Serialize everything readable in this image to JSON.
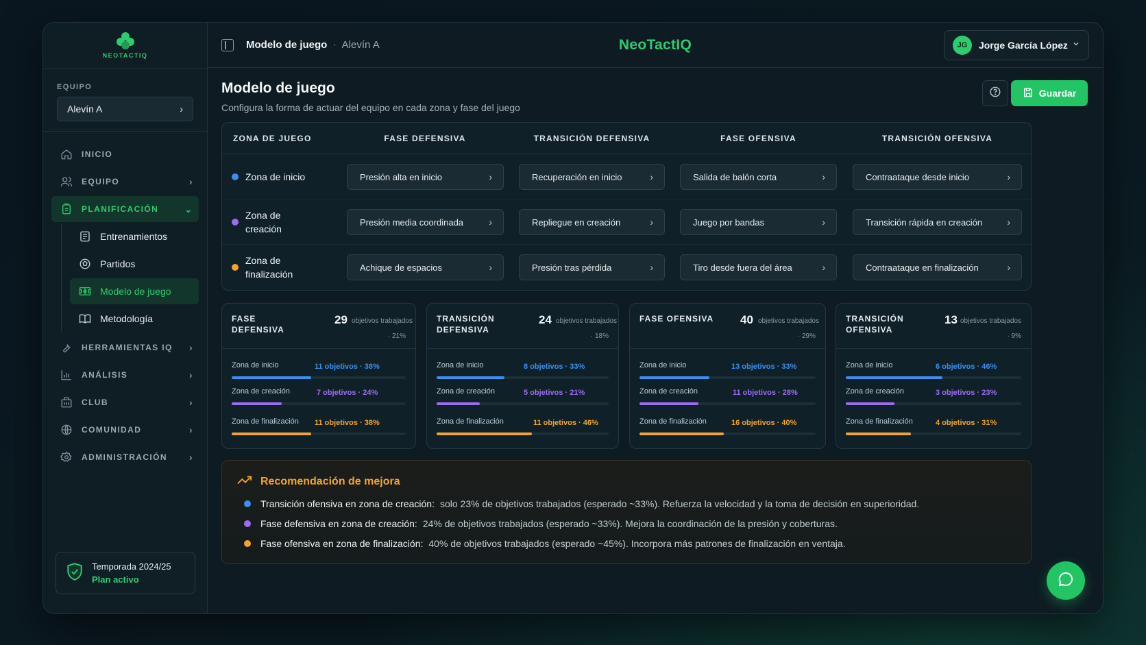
{
  "brand": {
    "logo_text": "NEOTACTIQ",
    "name": "NeoTactIQ"
  },
  "sidebar": {
    "team_label": "EQUIPO",
    "team_value": "Alevín A",
    "nav": [
      {
        "label": "INICIO",
        "icon": "home-icon"
      },
      {
        "label": "EQUIPO",
        "icon": "users-icon"
      },
      {
        "label": "PLANIFICACIÓN",
        "icon": "clipboard-icon"
      },
      {
        "label": "HERRAMIENTAS IQ",
        "icon": "wrench-icon"
      },
      {
        "label": "ANÁLISIS",
        "icon": "chart-icon"
      },
      {
        "label": "CLUB",
        "icon": "building-icon"
      },
      {
        "label": "COMUNIDAD",
        "icon": "globe-icon"
      },
      {
        "label": "ADMINISTRACIÓN",
        "icon": "gear-icon"
      }
    ],
    "sub_nav": [
      {
        "label": "Entrenamientos",
        "icon": "list-icon"
      },
      {
        "label": "Partidos",
        "icon": "ball-icon"
      },
      {
        "label": "Modelo de juego",
        "icon": "field-icon"
      },
      {
        "label": "Metodología",
        "icon": "book-icon"
      }
    ],
    "season": {
      "title": "Temporada 2024/25",
      "plan": "Plan activo"
    }
  },
  "header": {
    "breadcrumb_main": "Modelo de juego",
    "breadcrumb_sep": "·",
    "breadcrumb_sub": "Alevín A",
    "user_initials": "JG",
    "user_name": "Jorge García López"
  },
  "page": {
    "title": "Modelo de juego",
    "subtitle": "Configura la forma de actuar del equipo en cada zona y fase del juego",
    "save_label": "Guardar"
  },
  "matrix": {
    "headers": [
      "ZONA DE JUEGO",
      "FASE DEFENSIVA",
      "TRANSICIÓN DEFENSIVA",
      "FASE OFENSIVA",
      "TRANSICIÓN OFENSIVA"
    ],
    "rows": [
      {
        "zone_line1": "Zona de inicio",
        "zone_line2": "",
        "color": "#3b8ff0",
        "cells": [
          "Presión alta en inicio",
          "Recuperación en inicio",
          "Salida de balón corta",
          "Contraataque desde inicio"
        ]
      },
      {
        "zone_line1": "Zona de",
        "zone_line2": "creación",
        "color": "#9b6cf2",
        "cells": [
          "Presión media coordinada",
          "Repliegue en creación",
          "Juego por bandas",
          "Transición rápida en creación"
        ]
      },
      {
        "zone_line1": "Zona de",
        "zone_line2": "finalización",
        "color": "#f2a52c",
        "cells": [
          "Achique de espacios",
          "Presión tras pérdida",
          "Tiro desde fuera del área",
          "Contraataque en finalización"
        ]
      }
    ]
  },
  "stats": {
    "unit": "objetivos trabajados",
    "zone_colors": [
      "#3b8ff0",
      "#9b6cf2",
      "#f2a52c"
    ],
    "cards": [
      {
        "title_l1": "FASE",
        "title_l2": "DEFENSIVA",
        "total": "29",
        "share": "· 21%",
        "rows": [
          {
            "name": "Zona de inicio",
            "value": "11 objetivos · 38%",
            "fraction": 0.38
          },
          {
            "name": "Zona de creación",
            "value": "7 objetivos · 24%",
            "fraction": 0.24
          },
          {
            "name": "Zona de finalización",
            "value": "11 objetivos · 38%",
            "fraction": 0.38
          }
        ]
      },
      {
        "title_l1": "TRANSICIÓN",
        "title_l2": "DEFENSIVA",
        "total": "24",
        "share": "· 18%",
        "rows": [
          {
            "name": "Zona de inicio",
            "value": "8 objetivos · 33%",
            "fraction": 0.33
          },
          {
            "name": "Zona de creación",
            "value": "5 objetivos · 21%",
            "fraction": 0.21
          },
          {
            "name": "Zona de finalización",
            "value": "11 objetivos · 46%",
            "fraction": 0.46
          }
        ]
      },
      {
        "title_l1": "FASE OFENSIVA",
        "title_l2": "",
        "total": "40",
        "share": "· 29%",
        "rows": [
          {
            "name": "Zona de inicio",
            "value": "13 objetivos · 33%",
            "fraction": 0.33
          },
          {
            "name": "Zona de creación",
            "value": "11 objetivos · 28%",
            "fraction": 0.28
          },
          {
            "name": "Zona de finalización",
            "value": "16 objetivos · 40%",
            "fraction": 0.4
          }
        ]
      },
      {
        "title_l1": "TRANSICIÓN",
        "title_l2": "OFENSIVA",
        "total": "13",
        "share": "· 9%",
        "rows": [
          {
            "name": "Zona de inicio",
            "value": "6 objetivos · 46%",
            "fraction": 0.46
          },
          {
            "name": "Zona de creación",
            "value": "3 objetivos · 23%",
            "fraction": 0.23
          },
          {
            "name": "Zona de finalización",
            "value": "4 objetivos · 31%",
            "fraction": 0.31
          }
        ]
      }
    ]
  },
  "recommendation": {
    "title": "Recomendación de mejora",
    "items": [
      {
        "bold": "Transición ofensiva en zona de creación:",
        "text": "solo 23% de objetivos trabajados (esperado ~33%). Refuerza la velocidad y la toma de decisión en superioridad.",
        "color": "#3b8ff0"
      },
      {
        "bold": "Fase defensiva en zona de creación:",
        "text": "24% de objetivos trabajados (esperado ~33%). Mejora la coordinación de la presión y coberturas.",
        "color": "#9b6cf2"
      },
      {
        "bold": "Fase ofensiva en zona de finalización:",
        "text": "40% de objetivos trabajados (esperado ~45%). Incorpora más patrones de finalización en ventaja.",
        "color": "#f2a52c"
      }
    ]
  }
}
